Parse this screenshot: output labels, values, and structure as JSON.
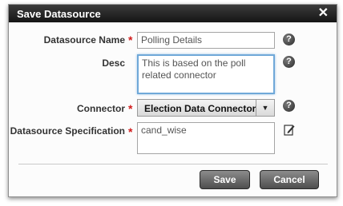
{
  "dialog": {
    "title": "Save Datasource",
    "close_glyph": "✕"
  },
  "form": {
    "name_label": "Datasource Name",
    "name_value": "Polling Details",
    "desc_label": "Desc",
    "desc_value": "This is based on the poll related connector",
    "connector_label": "Connector",
    "connector_value": "Election Data Connector(",
    "spec_label": "Datasource Specification",
    "spec_value": "cand_wise",
    "required_mark": "*",
    "help_glyph": "?"
  },
  "buttons": {
    "save": "Save",
    "cancel": "Cancel"
  },
  "icons": {
    "help": "question-circle-icon",
    "edit": "edit-pencil-icon",
    "dropdown": "chevron-down-icon",
    "close": "close-icon"
  },
  "colors": {
    "titlebar": "#222222",
    "required": "#d21b1b",
    "focus_border": "#6fa8d8",
    "button": "#6a6a6a"
  }
}
